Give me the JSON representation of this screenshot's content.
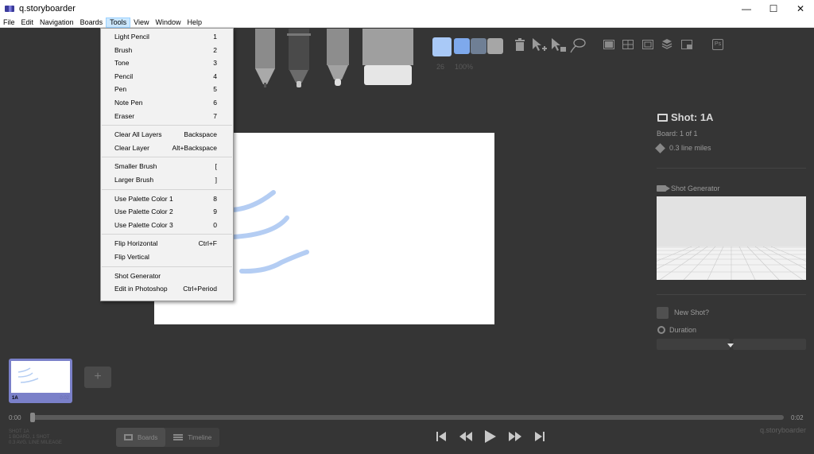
{
  "window": {
    "title": "q.storyboarder",
    "controls": {
      "minimize": "—",
      "maximize": "☐",
      "close": "✕"
    }
  },
  "menubar": {
    "items": [
      {
        "label": "File",
        "active": false
      },
      {
        "label": "Edit",
        "active": false
      },
      {
        "label": "Navigation",
        "active": false
      },
      {
        "label": "Boards",
        "active": false
      },
      {
        "label": "Tools",
        "active": true
      },
      {
        "label": "View",
        "active": false
      },
      {
        "label": "Window",
        "active": false
      },
      {
        "label": "Help",
        "active": false
      }
    ]
  },
  "tools_menu": {
    "groups": [
      [
        {
          "label": "Light Pencil",
          "accel": "1"
        },
        {
          "label": "Brush",
          "accel": "2"
        },
        {
          "label": "Tone",
          "accel": "3"
        },
        {
          "label": "Pencil",
          "accel": "4"
        },
        {
          "label": "Pen",
          "accel": "5"
        },
        {
          "label": "Note Pen",
          "accel": "6"
        },
        {
          "label": "Eraser",
          "accel": "7"
        }
      ],
      [
        {
          "label": "Clear All Layers",
          "accel": "Backspace"
        },
        {
          "label": "Clear Layer",
          "accel": "Alt+Backspace"
        }
      ],
      [
        {
          "label": "Smaller Brush",
          "accel": "["
        },
        {
          "label": "Larger Brush",
          "accel": "]"
        }
      ],
      [
        {
          "label": "Use Palette Color 1",
          "accel": "8"
        },
        {
          "label": "Use Palette Color 2",
          "accel": "9"
        },
        {
          "label": "Use Palette Color 3",
          "accel": "0"
        }
      ],
      [
        {
          "label": "Flip Horizontal",
          "accel": "Ctrl+F"
        },
        {
          "label": "Flip Vertical",
          "accel": ""
        }
      ],
      [
        {
          "label": "Shot Generator",
          "accel": ""
        },
        {
          "label": "Edit in Photoshop",
          "accel": "Ctrl+Period"
        }
      ]
    ]
  },
  "toolbar": {
    "brush_size": "26",
    "brush_opacity": "100%",
    "colors": [
      "#a9c9f7",
      "#7ea9ec",
      "#6f7f95",
      "#a6a6a6"
    ],
    "icons": [
      "trash-icon",
      "pointer-add-icon",
      "pointer-move-icon",
      "lasso-icon",
      "grid-single-icon",
      "grid-quad-icon",
      "grid-frame-icon",
      "layers-icon",
      "onion-icon",
      "photoshop-icon"
    ],
    "photoshop_label": "Ps"
  },
  "shot": {
    "title": "Shot: 1A",
    "board_of": "Board: 1 of 1",
    "line_miles": "0.3 line miles",
    "shot_generator": "Shot Generator",
    "new_shot": "New Shot?",
    "duration": "Duration"
  },
  "thumbnail": {
    "label": "1A",
    "duration": "0:02"
  },
  "timeline": {
    "start": "0:00",
    "end": "0:02",
    "position": 0
  },
  "info": [
    "SHOT 1A",
    "1 BOARD, 1 SHOT",
    "0.3 AVG. LINE MILEAGE"
  ],
  "modes": {
    "boards": "Boards",
    "timeline": "Timeline"
  },
  "transport": {
    "first": "⏮",
    "prev": "⏪",
    "play": "▶",
    "next": "⏩",
    "last": "⏭"
  },
  "brand": "q.storyboarder"
}
